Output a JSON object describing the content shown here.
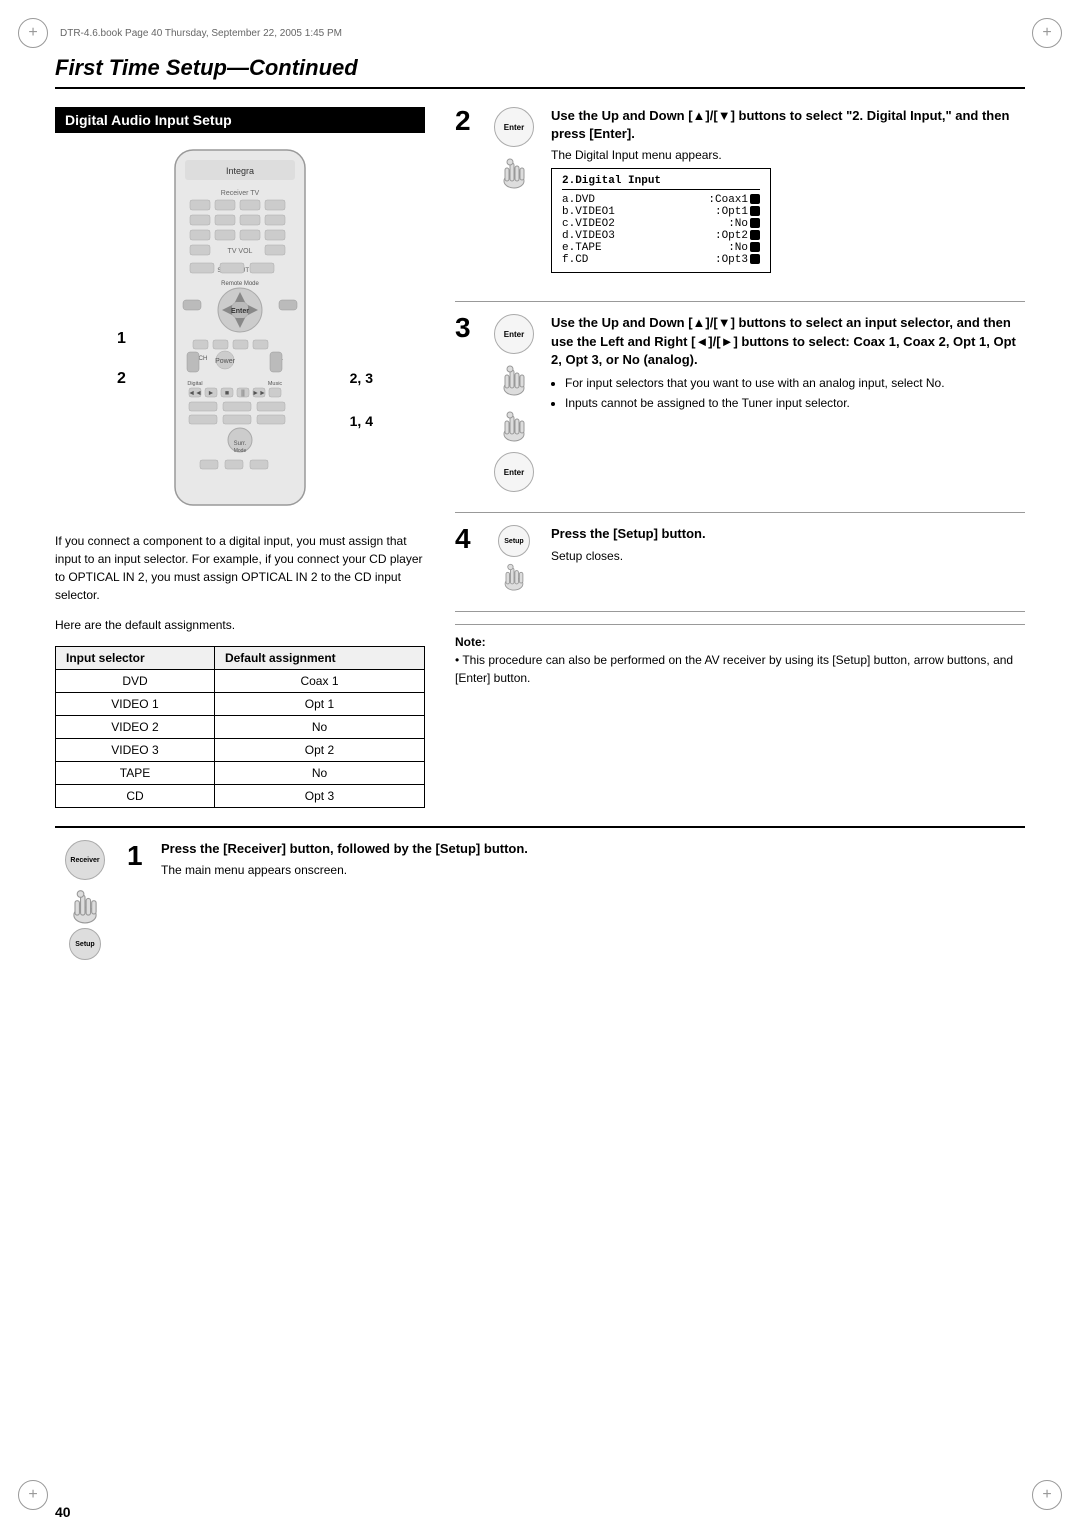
{
  "meta": {
    "file_info": "DTR-4.6.book  Page 40  Thursday, September 22, 2005  1:45 PM"
  },
  "page": {
    "title": "First Time Setup",
    "title_continued": "—Continued",
    "number": "40"
  },
  "section": {
    "heading": "Digital Audio Input Setup"
  },
  "remote_labels": {
    "label1": "1",
    "label2": "2",
    "label_2_3": "2, 3",
    "label_1_4": "1, 4"
  },
  "description": {
    "para1": "If you connect a component to a digital input, you must assign that input to an input selector. For example, if you connect your CD player to OPTICAL IN 2, you must assign OPTICAL IN 2 to the CD input selector.",
    "para2": "Here are the default assignments."
  },
  "table": {
    "col1_header": "Input selector",
    "col2_header": "Default assignment",
    "rows": [
      {
        "selector": "DVD",
        "assignment": "Coax 1"
      },
      {
        "selector": "VIDEO 1",
        "assignment": "Opt 1"
      },
      {
        "selector": "VIDEO 2",
        "assignment": "No"
      },
      {
        "selector": "VIDEO 3",
        "assignment": "Opt 2"
      },
      {
        "selector": "TAPE",
        "assignment": "No"
      },
      {
        "selector": "CD",
        "assignment": "Opt 3"
      }
    ]
  },
  "steps": {
    "step1_bottom": {
      "number": "1",
      "title": "Press the [Receiver] button, followed by the [Setup] button.",
      "subtitle": "The main menu appears onscreen."
    },
    "step2": {
      "number": "2",
      "title": "Use the Up and Down [▲]/[▼] buttons to select \"2. Digital Input,\" and then press [Enter].",
      "subtitle": "The Digital Input menu appears.",
      "osd": {
        "title": "2.Digital Input",
        "rows": [
          {
            "label": "a.DVD",
            "value": ":Coax1"
          },
          {
            "label": "b.VIDEO1",
            "value": ":Opt1"
          },
          {
            "label": "c.VIDEO2",
            "value": ":No"
          },
          {
            "label": "d.VIDEO3",
            "value": ":Opt2"
          },
          {
            "label": "e.TAPE",
            "value": ":No"
          },
          {
            "label": "f.CD",
            "value": ":Opt3"
          }
        ]
      }
    },
    "step3": {
      "number": "3",
      "title": "Use the Up and Down [▲]/[▼] buttons to select an input selector, and then use the Left and Right [◄]/[►] buttons to select: Coax 1, Coax 2, Opt 1, Opt 2, Opt 3, or No (analog).",
      "bullet1": "For input selectors that you want to use with an analog input, select No.",
      "bullet2": "Inputs cannot be assigned to the Tuner input selector."
    },
    "step4": {
      "number": "4",
      "title": "Press the [Setup] button.",
      "subtitle": "Setup closes."
    }
  },
  "note": {
    "label": "Note:",
    "text": "This procedure can also be performed on the AV receiver by using its [Setup] button, arrow buttons, and [Enter] button."
  },
  "icons": {
    "enter_button": "Enter",
    "setup_button": "Setup",
    "receiver_button": "Receiver"
  }
}
